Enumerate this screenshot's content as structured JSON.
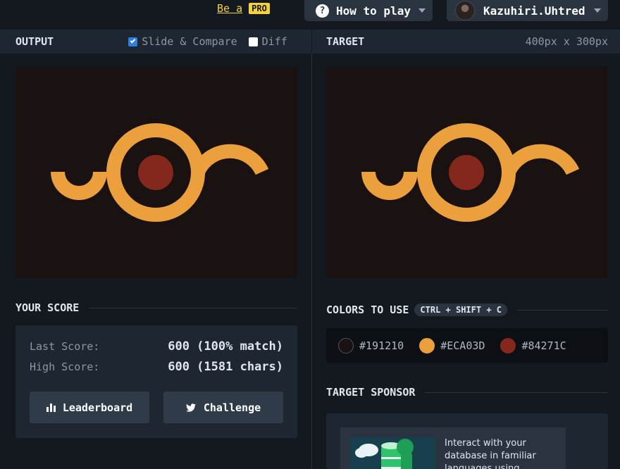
{
  "topbar": {
    "be_a": "Be a",
    "pro_badge": "PRO",
    "how_to_play": "How to play",
    "question_glyph": "?",
    "username": "Kazuhiri.Uhtred"
  },
  "output_panel": {
    "title": "OUTPUT",
    "slide_compare_label": "Slide & Compare",
    "slide_compare_checked": true,
    "diff_label": "Diff",
    "diff_checked": false
  },
  "target_panel": {
    "title": "TARGET",
    "dimensions": "400px x 300px"
  },
  "score": {
    "title": "YOUR SCORE",
    "last_score_label": "Last Score:",
    "last_score_value": "600 (100% match)",
    "high_score_label": "High Score:",
    "high_score_value": "600 (1581 chars)",
    "leaderboard_label": "Leaderboard",
    "challenge_label": "Challenge"
  },
  "colors_to_use": {
    "title": "COLORS TO USE",
    "shortcut": "CTRL + SHIFT + C",
    "colors": [
      {
        "hex": "#191210",
        "label": "#191210"
      },
      {
        "hex": "#ECA03D",
        "label": "#ECA03D"
      },
      {
        "hex": "#84271C",
        "label": "#84271C"
      }
    ]
  },
  "sponsor": {
    "title": "TARGET SPONSOR",
    "ad_text": "Interact with your database in familiar languages using"
  },
  "icons": {
    "question": "question-circle-icon",
    "bars": "bar-chart-icon",
    "twitter": "twitter-icon",
    "caret": "chevron-down-icon"
  }
}
